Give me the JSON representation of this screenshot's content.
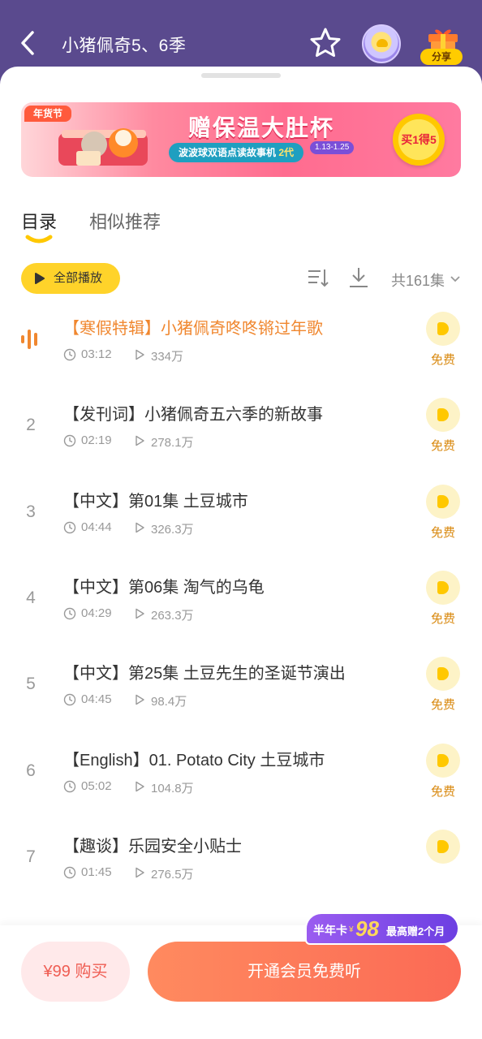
{
  "header": {
    "title": "小猪佩奇5、6季",
    "share_label": "分享",
    "icons": {
      "back": "back-chevron-icon",
      "favorite": "star-icon",
      "avatar": "robot-avatar-icon",
      "share": "gift-icon"
    }
  },
  "banner": {
    "badge": "年货节",
    "title": "赠保温大肚杯",
    "subtitle_a": "波波球双语点读故事机",
    "subtitle_b": "2代",
    "date": "1.13-1.25",
    "cta": "买1得5"
  },
  "tabs": [
    {
      "label": "目录",
      "active": true
    },
    {
      "label": "相似推荐",
      "active": false
    }
  ],
  "controls": {
    "play_all": "全部播放",
    "episode_count": "共161集",
    "icons": {
      "sort": "sort-icon",
      "download": "download-icon",
      "expand": "chevron-down-icon"
    }
  },
  "episodes": [
    {
      "index": "",
      "playing": true,
      "title": "【寒假特辑】小猪佩奇咚咚锵过年歌",
      "duration": "03:12",
      "plays": "334万",
      "tag": "免费"
    },
    {
      "index": "2",
      "playing": false,
      "title": "【发刊词】小猪佩奇五六季的新故事",
      "duration": "02:19",
      "plays": "278.1万",
      "tag": "免费"
    },
    {
      "index": "3",
      "playing": false,
      "title": "【中文】第01集 土豆城市",
      "duration": "04:44",
      "plays": "326.3万",
      "tag": "免费"
    },
    {
      "index": "4",
      "playing": false,
      "title": "【中文】第06集 淘气的乌龟",
      "duration": "04:29",
      "plays": "263.3万",
      "tag": "免费"
    },
    {
      "index": "5",
      "playing": false,
      "title": "【中文】第25集 土豆先生的圣诞节演出",
      "duration": "04:45",
      "plays": "98.4万",
      "tag": "免费"
    },
    {
      "index": "6",
      "playing": false,
      "title": "【English】01. Potato City 土豆城市",
      "duration": "05:02",
      "plays": "104.8万",
      "tag": "免费"
    },
    {
      "index": "7",
      "playing": false,
      "title": "【趣谈】乐园安全小贴士",
      "duration": "01:45",
      "plays": "276.5万",
      "tag": ""
    }
  ],
  "bottom": {
    "buy_label": "¥99 购买",
    "member_label": "开通会员免费听",
    "promo_a": "半年卡",
    "promo_yen": "¥",
    "promo_price": "98",
    "promo_b": "最高赠2个月"
  },
  "colors": {
    "header_bg": "#5a4a8e",
    "accent_yellow": "#ffd32a",
    "active_orange": "#f0872f",
    "cta_orange": "#fb6a55"
  }
}
